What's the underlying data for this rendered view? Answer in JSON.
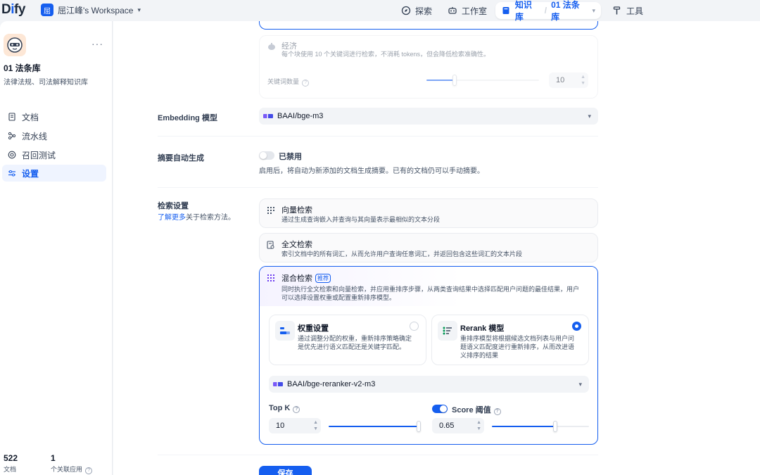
{
  "brand": {
    "logo": "Dify"
  },
  "workspace": {
    "badge": "屈",
    "name": "屈江峰's Workspace"
  },
  "nav": {
    "explore": "探索",
    "studio": "工作室",
    "knowledge": "知识库",
    "current_kb": "01 法条库",
    "tools": "工具"
  },
  "sidebar": {
    "kb_name": "01 法条库",
    "kb_desc": "法律法规、司法解释知识库",
    "items": [
      {
        "label": "文档",
        "icon": "document-icon"
      },
      {
        "label": "流水线",
        "icon": "pipeline-icon"
      },
      {
        "label": "召回测试",
        "icon": "target-icon"
      },
      {
        "label": "设置",
        "icon": "settings-icon"
      }
    ],
    "stats": [
      {
        "value": "522",
        "label": "文档"
      },
      {
        "value": "1",
        "label": "个关联应用"
      }
    ]
  },
  "economy": {
    "title": "经济",
    "desc": "每个块使用 10 个关键词进行检索，不消耗 tokens，但会降低检索准确性。",
    "keyword_label": "关键词数量",
    "keyword_value": "10",
    "keyword_level": 0.25
  },
  "embedding": {
    "label": "Embedding 模型",
    "model": "BAAI/bge-m3"
  },
  "summary": {
    "label": "摘要自动生成",
    "status": "已禁用",
    "enabled": false,
    "desc": "启用后，将自动为新添加的文档生成摘要。已有的文档仍可以手动摘要。"
  },
  "retrieval": {
    "label": "检索设置",
    "learn_more": "了解更多",
    "learn_more_suffix": "关于检索方法。",
    "vector": {
      "title": "向量检索",
      "desc": "通过生成查询嵌入并查询与其向量表示最相似的文本分段"
    },
    "fulltext": {
      "title": "全文检索",
      "desc": "索引文档中的所有词汇，从而允许用户查询任意词汇，并返回包含这些词汇的文本片段"
    },
    "hybrid": {
      "title": "混合检索",
      "badge": "推荐",
      "desc_line1": "同时执行全文检索和向量检索，并应用重排序步骤，从两类查询结果中选择匹配用户问题的最佳结果，用户",
      "desc_line2": "可以选择设置权重或配置重新排序模型。"
    },
    "weight": {
      "title": "权重设置",
      "desc_line1": "通过调整分配的权重，重新排序策略确定",
      "desc_line2": "是优先进行语义匹配还是关键字匹配。",
      "selected": false
    },
    "rerank": {
      "title": "Rerank 模型",
      "desc_line1": "重排序模型将根据候选文档列表与用户问",
      "desc_line2": "题语义匹配度进行重新排序，从而改进语",
      "desc_line3": "义排序的结果",
      "selected": true
    },
    "rerank_model": "BAAI/bge-reranker-v2-m3",
    "top_k": {
      "label": "Top K",
      "value": "10",
      "level": 1.0
    },
    "score": {
      "label": "Score 阈值",
      "value": "0.65",
      "level": 0.65,
      "enabled": true
    }
  },
  "save_label": "保存",
  "colors": {
    "accent": "#155eef",
    "border_active": "#155eef"
  }
}
